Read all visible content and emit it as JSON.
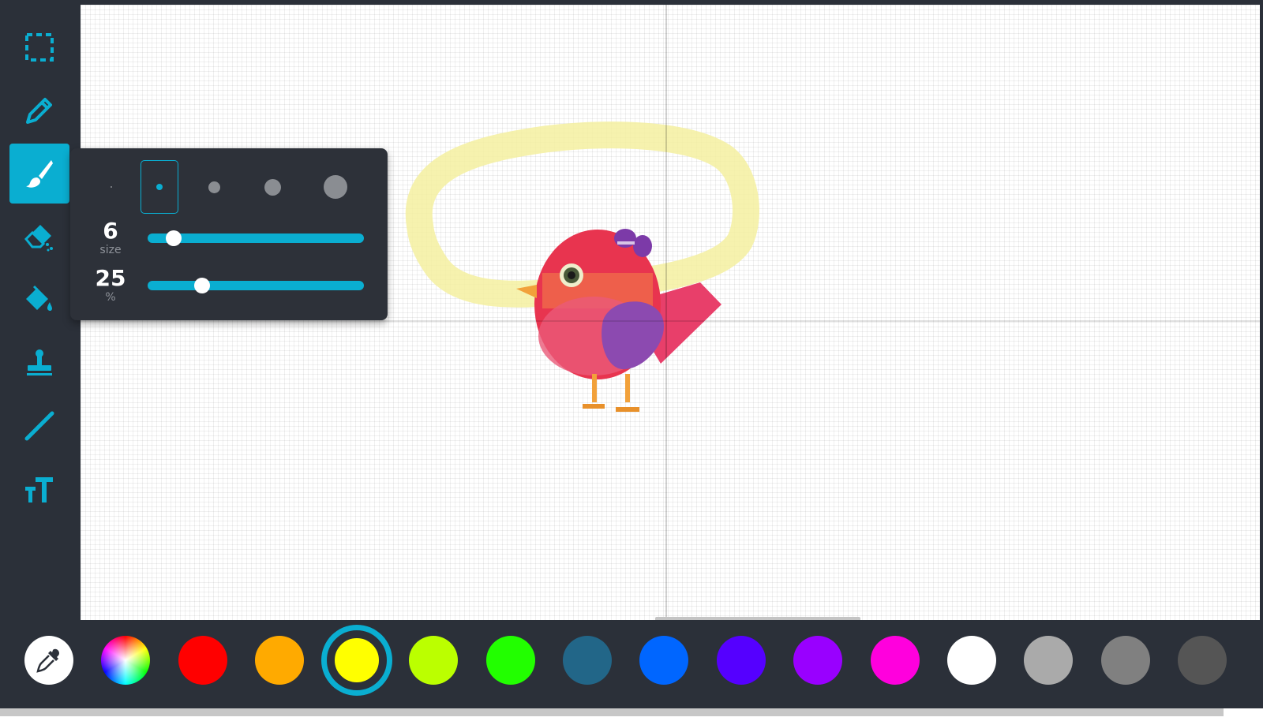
{
  "toolbar": {
    "tools": [
      {
        "id": "select",
        "icon": "selection-icon",
        "active": false
      },
      {
        "id": "pencil",
        "icon": "pencil-icon",
        "active": false
      },
      {
        "id": "brush",
        "icon": "brush-icon",
        "active": true
      },
      {
        "id": "eraser",
        "icon": "eraser-icon",
        "active": false
      },
      {
        "id": "fill",
        "icon": "paint-bucket-icon",
        "active": false
      },
      {
        "id": "stamp",
        "icon": "stamp-icon",
        "active": false
      },
      {
        "id": "line",
        "icon": "line-icon",
        "active": false
      },
      {
        "id": "text",
        "icon": "text-icon",
        "active": false
      }
    ],
    "accent_color": "#0aaed1"
  },
  "brush_popup": {
    "size_presets": 5,
    "selected_preset": 2,
    "size_value": "6",
    "size_label": "size",
    "size_fraction": 0.12,
    "opacity_value": "25",
    "opacity_label": "%",
    "opacity_fraction": 0.25
  },
  "zoom": {
    "zoom_out_label": "−",
    "zoom_in_label": "+"
  },
  "palette": {
    "selected_color": "#ffff00",
    "colors": [
      "#ff0000",
      "#ffaa00",
      "#ffff00",
      "#bbff00",
      "#22ff00",
      "#226688",
      "#0066ff",
      "#5500ff",
      "#9900ff",
      "#ff00dd",
      "#ffffff",
      "#aaaaaa",
      "#808080",
      "#555555"
    ]
  },
  "canvas": {
    "background": "#ffffff",
    "highlight_stroke_color": "#f5f0a0"
  }
}
